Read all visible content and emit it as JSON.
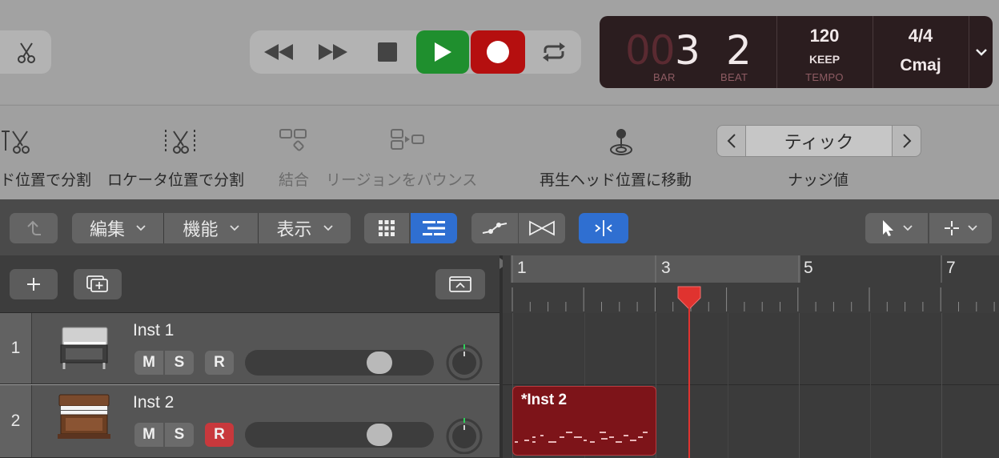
{
  "lcd": {
    "bar_prefix": "00",
    "bar": "3",
    "beat": "2",
    "bar_label": "BAR",
    "beat_label": "BEAT",
    "tempo": "120",
    "tempo_mode": "KEEP",
    "tempo_label": "TEMPO",
    "time_signature": "4/4",
    "key": "Cmaj"
  },
  "toolbar": {
    "split_playhead": "ド位置で分割",
    "split_locators": "ロケータ位置で分割",
    "join": "結合",
    "bounce": "リージョンをバウンス",
    "goto_playhead": "再生ヘッド位置に移動",
    "nudge_value": "ティック",
    "nudge_label": "ナッジ値"
  },
  "editor_menus": {
    "edit": "編集",
    "functions": "機能",
    "view": "表示"
  },
  "ruler": {
    "bars": [
      "1",
      "3",
      "5",
      "7"
    ]
  },
  "tracks": [
    {
      "number": "1",
      "name": "Inst 1",
      "m": "M",
      "s": "S",
      "r": "R",
      "record_armed": false
    },
    {
      "number": "2",
      "name": "Inst 2",
      "m": "M",
      "s": "S",
      "r": "R",
      "record_armed": true
    }
  ],
  "region": {
    "name": "*Inst 2"
  },
  "colors": {
    "play": "#1f8f2e",
    "record": "#b50f0f",
    "region": "#7d1419",
    "playhead": "#e0332f",
    "active_blue": "#2f6fd1"
  }
}
